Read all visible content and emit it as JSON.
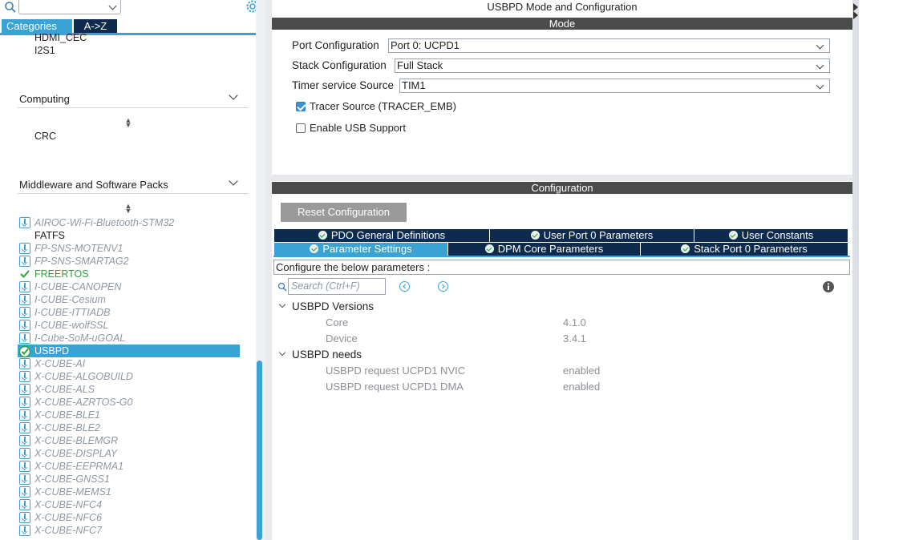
{
  "window_title": "USBPD Mode and Configuration",
  "left": {
    "tabs": {
      "categories": "Categories",
      "az": "A->Z"
    },
    "partial_top": [
      "HDMI_CEC",
      "I2S1"
    ],
    "computing": {
      "title": "Computing",
      "items": [
        "CRC"
      ]
    },
    "middleware": {
      "title": "Middleware and Software Packs",
      "items": [
        {
          "label": "AIROC-Wi-Fi-Bluetooth-STM32",
          "state": "download"
        },
        {
          "label": "FATFS",
          "state": "normal"
        },
        {
          "label": "FP-SNS-MOTENV1",
          "state": "download"
        },
        {
          "label": "FP-SNS-SMARTAG2",
          "state": "download"
        },
        {
          "label": "FREERTOS",
          "state": "enabled"
        },
        {
          "label": "I-CUBE-CANOPEN",
          "state": "download"
        },
        {
          "label": "I-CUBE-Cesium",
          "state": "download"
        },
        {
          "label": "I-CUBE-ITTIADB",
          "state": "download"
        },
        {
          "label": "I-CUBE-wolfSSL",
          "state": "download"
        },
        {
          "label": "I-Cube-SoM-uGOAL",
          "state": "download"
        },
        {
          "label": "USBPD",
          "state": "selected"
        },
        {
          "label": "X-CUBE-AI",
          "state": "download"
        },
        {
          "label": "X-CUBE-ALGOBUILD",
          "state": "download"
        },
        {
          "label": "X-CUBE-ALS",
          "state": "download"
        },
        {
          "label": "X-CUBE-AZRTOS-G0",
          "state": "download"
        },
        {
          "label": "X-CUBE-BLE1",
          "state": "download"
        },
        {
          "label": "X-CUBE-BLE2",
          "state": "download"
        },
        {
          "label": "X-CUBE-BLEMGR",
          "state": "download"
        },
        {
          "label": "X-CUBE-DISPLAY",
          "state": "download"
        },
        {
          "label": "X-CUBE-EEPRMA1",
          "state": "download"
        },
        {
          "label": "X-CUBE-GNSS1",
          "state": "download"
        },
        {
          "label": "X-CUBE-MEMS1",
          "state": "download"
        },
        {
          "label": "X-CUBE-NFC4",
          "state": "download"
        },
        {
          "label": "X-CUBE-NFC6",
          "state": "download"
        },
        {
          "label": "X-CUBE-NFC7",
          "state": "download"
        }
      ]
    }
  },
  "mode": {
    "bar": "Mode",
    "fields": [
      {
        "label": "Port Configuration",
        "value": "Port 0: UCPD1"
      },
      {
        "label": "Stack Configuration",
        "value": "Full Stack"
      },
      {
        "label": "Timer service Source",
        "value": "TIM1"
      }
    ],
    "checks": [
      {
        "label": "Tracer Source (TRACER_EMB)",
        "checked": true
      },
      {
        "label": "Enable USB Support",
        "checked": false
      }
    ]
  },
  "config": {
    "bar": "Configuration",
    "reset_label": "Reset Configuration",
    "tabs_row1": [
      "PDO General Definitions",
      "User Port 0 Parameters",
      "User Constants"
    ],
    "tabs_row2": [
      "Parameter Settings",
      "DPM Core Parameters",
      "Stack Port 0 Parameters"
    ],
    "active_tab": "Parameter Settings",
    "hint": "Configure the below parameters :",
    "search_placeholder": "Search (Ctrl+F)",
    "groups": [
      {
        "title": "USBPD Versions",
        "rows": [
          {
            "k": "Core",
            "v": "4.1.0"
          },
          {
            "k": "Device",
            "v": "3.4.1"
          }
        ]
      },
      {
        "title": "USBPD needs",
        "rows": [
          {
            "k": "USBPD request UCPD1 NVIC",
            "v": "enabled"
          },
          {
            "k": "USBPD request UCPD1 DMA",
            "v": "enabled"
          }
        ]
      }
    ]
  },
  "colors": {
    "accent": "#3aa3d6",
    "navy": "#0e2a4e",
    "enabled_green": "#2ea040",
    "bar_gray": "#4b4b4b"
  }
}
